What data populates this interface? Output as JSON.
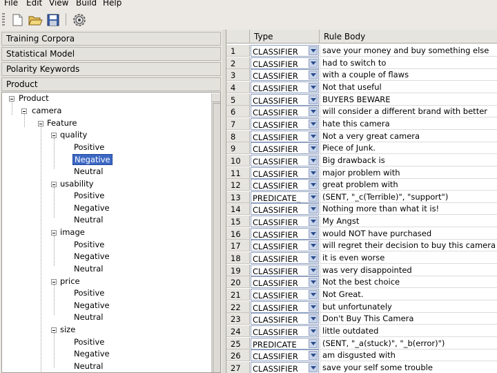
{
  "menu": [
    "File",
    "Edit",
    "View",
    "Build",
    "Help"
  ],
  "toolbar": {
    "icons": [
      "new-file-icon",
      "open-folder-icon",
      "save-icon",
      "settings-gear-icon"
    ]
  },
  "left_panel": {
    "sections": [
      "Training Corpora",
      "Statistical Model",
      "Polarity Keywords",
      "Product"
    ],
    "tree": {
      "root": "Product",
      "camera": "camera",
      "feature": "Feature",
      "groups": [
        {
          "name": "quality",
          "children": [
            "Positive",
            "Negative",
            "Neutral"
          ]
        },
        {
          "name": "usability",
          "children": [
            "Positive",
            "Negative",
            "Neutral"
          ]
        },
        {
          "name": "image",
          "children": [
            "Positive",
            "Negative",
            "Neutral"
          ]
        },
        {
          "name": "price",
          "children": [
            "Positive",
            "Negative",
            "Neutral"
          ]
        },
        {
          "name": "size",
          "children": [
            "Positive",
            "Negative",
            "Neutral"
          ]
        }
      ],
      "selected": "quality/Negative"
    }
  },
  "table": {
    "headers": [
      "Type",
      "Rule Body"
    ],
    "rows": [
      {
        "n": "1",
        "type": "CLASSIFIER",
        "body": "save your money and buy something else"
      },
      {
        "n": "2",
        "type": "CLASSIFIER",
        "body": "had to switch to"
      },
      {
        "n": "3",
        "type": "CLASSIFIER",
        "body": "with a couple of flaws"
      },
      {
        "n": "4",
        "type": "CLASSIFIER",
        "body": "Not that useful"
      },
      {
        "n": "5",
        "type": "CLASSIFIER",
        "body": "BUYERS BEWARE"
      },
      {
        "n": "6",
        "type": "CLASSIFIER",
        "body": "will consider a different brand with better"
      },
      {
        "n": "7",
        "type": "CLASSIFIER",
        "body": "hate this camera"
      },
      {
        "n": "8",
        "type": "CLASSIFIER",
        "body": "Not a very great camera"
      },
      {
        "n": "9",
        "type": "CLASSIFIER",
        "body": "Piece of Junk."
      },
      {
        "n": "10",
        "type": "CLASSIFIER",
        "body": "Big drawback is"
      },
      {
        "n": "11",
        "type": "CLASSIFIER",
        "body": "major problem with"
      },
      {
        "n": "12",
        "type": "CLASSIFIER",
        "body": "great problem with"
      },
      {
        "n": "13",
        "type": "PREDICATE_",
        "body": "(SENT, \"_c(Terrible)\", \"support\")"
      },
      {
        "n": "14",
        "type": "CLASSIFIER",
        "body": "Nothing more than what it is!"
      },
      {
        "n": "15",
        "type": "CLASSIFIER",
        "body": "My Angst"
      },
      {
        "n": "16",
        "type": "CLASSIFIER",
        "body": "would NOT have purchased"
      },
      {
        "n": "17",
        "type": "CLASSIFIER",
        "body": "will regret their decision to buy this camera"
      },
      {
        "n": "18",
        "type": "CLASSIFIER",
        "body": "it is even worse"
      },
      {
        "n": "19",
        "type": "CLASSIFIER",
        "body": "was very disappointed"
      },
      {
        "n": "20",
        "type": "CLASSIFIER",
        "body": "Not the best choice"
      },
      {
        "n": "21",
        "type": "CLASSIFIER",
        "body": "Not Great."
      },
      {
        "n": "22",
        "type": "CLASSIFIER",
        "body": "but unfortunately"
      },
      {
        "n": "23",
        "type": "CLASSIFIER",
        "body": "Don't Buy This Camera"
      },
      {
        "n": "24",
        "type": "CLASSIFIER",
        "body": "little outdated"
      },
      {
        "n": "25",
        "type": "PREDICATE",
        "body": "(SENT, \"_a(stuck)\", \"_b(error)\")"
      },
      {
        "n": "26",
        "type": "CLASSIFIER",
        "body": "am disgusted with"
      },
      {
        "n": "27",
        "type": "CLASSIFIER",
        "body": "save your self some trouble"
      }
    ]
  }
}
